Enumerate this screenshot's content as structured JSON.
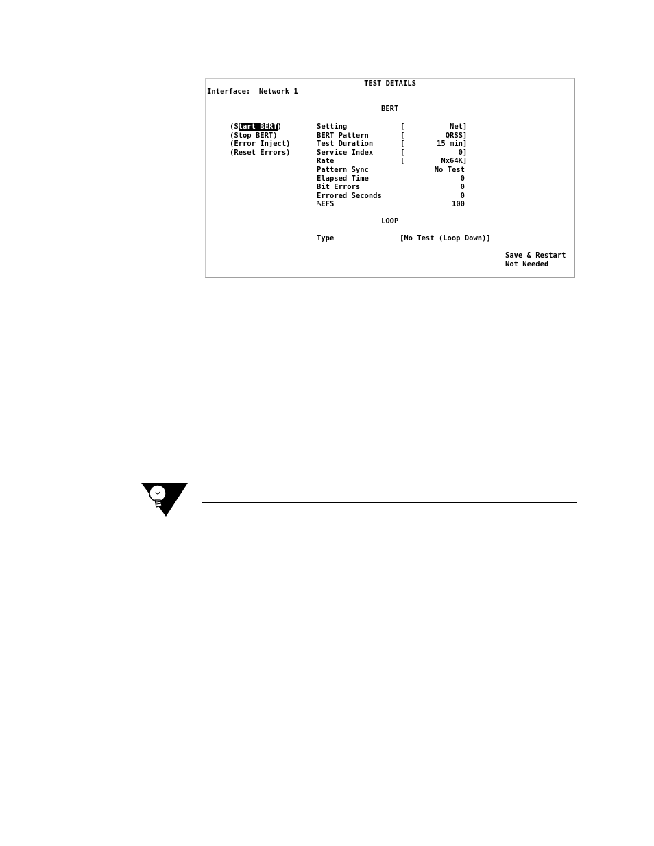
{
  "terminal": {
    "header_title": "TEST DETAILS",
    "interface_label": "Interface:",
    "interface_value": "Network 1",
    "bert_section": "BERT",
    "loop_section": "LOOP",
    "commands": [
      {
        "prefix": "(S",
        "highlight": "tart BERT",
        "suffix": ")"
      },
      {
        "prefix": "(Stop BERT)",
        "highlight": "",
        "suffix": ""
      },
      {
        "prefix": "(Error Inject)",
        "highlight": "",
        "suffix": ""
      },
      {
        "prefix": "(Reset Errors)",
        "highlight": "",
        "suffix": ""
      }
    ],
    "fields": [
      {
        "label": "Setting",
        "value": "Net",
        "editable": true
      },
      {
        "label": "BERT Pattern",
        "value": "QRSS",
        "editable": true
      },
      {
        "label": "Test Duration",
        "value": "15 min",
        "editable": true
      },
      {
        "label": "Service Index",
        "value": "0",
        "editable": true
      },
      {
        "label": "Rate",
        "value": "Nx64K",
        "editable": true
      },
      {
        "label": "Pattern Sync",
        "value": "No Test",
        "editable": false
      },
      {
        "label": "Elapsed Time",
        "value": "0",
        "editable": false
      },
      {
        "label": "Bit Errors",
        "value": "0",
        "editable": false
      },
      {
        "label": "Errored Seconds",
        "value": "0",
        "editable": false
      },
      {
        "label": "%EFS",
        "value": "100",
        "editable": false
      }
    ],
    "loop_type_label": "Type",
    "loop_type_value": "[No Test (Loop Down)]",
    "save_restart_line1": "Save & Restart",
    "save_restart_line2": "Not Needed"
  },
  "note_icon": "lightbulb-note-icon"
}
